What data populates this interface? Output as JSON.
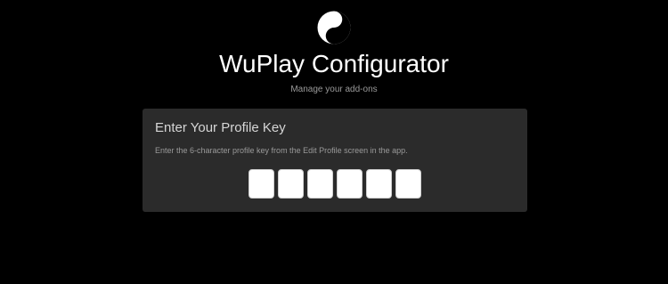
{
  "header": {
    "logo_icon": "yin-yang-icon",
    "title": "WuPlay Configurator",
    "subtitle": "Manage your add-ons"
  },
  "profile_card": {
    "title": "Enter Your Profile Key",
    "description": "Enter the 6-character profile key from the Edit Profile screen in the app.",
    "key_inputs": [
      {
        "value": ""
      },
      {
        "value": ""
      },
      {
        "value": ""
      },
      {
        "value": ""
      },
      {
        "value": ""
      },
      {
        "value": ""
      }
    ]
  },
  "colors": {
    "background": "#000000",
    "card_background": "#2b2b2b",
    "title_text": "#ffffff",
    "muted_text": "#9a9a9a",
    "input_background": "#ffffff"
  }
}
